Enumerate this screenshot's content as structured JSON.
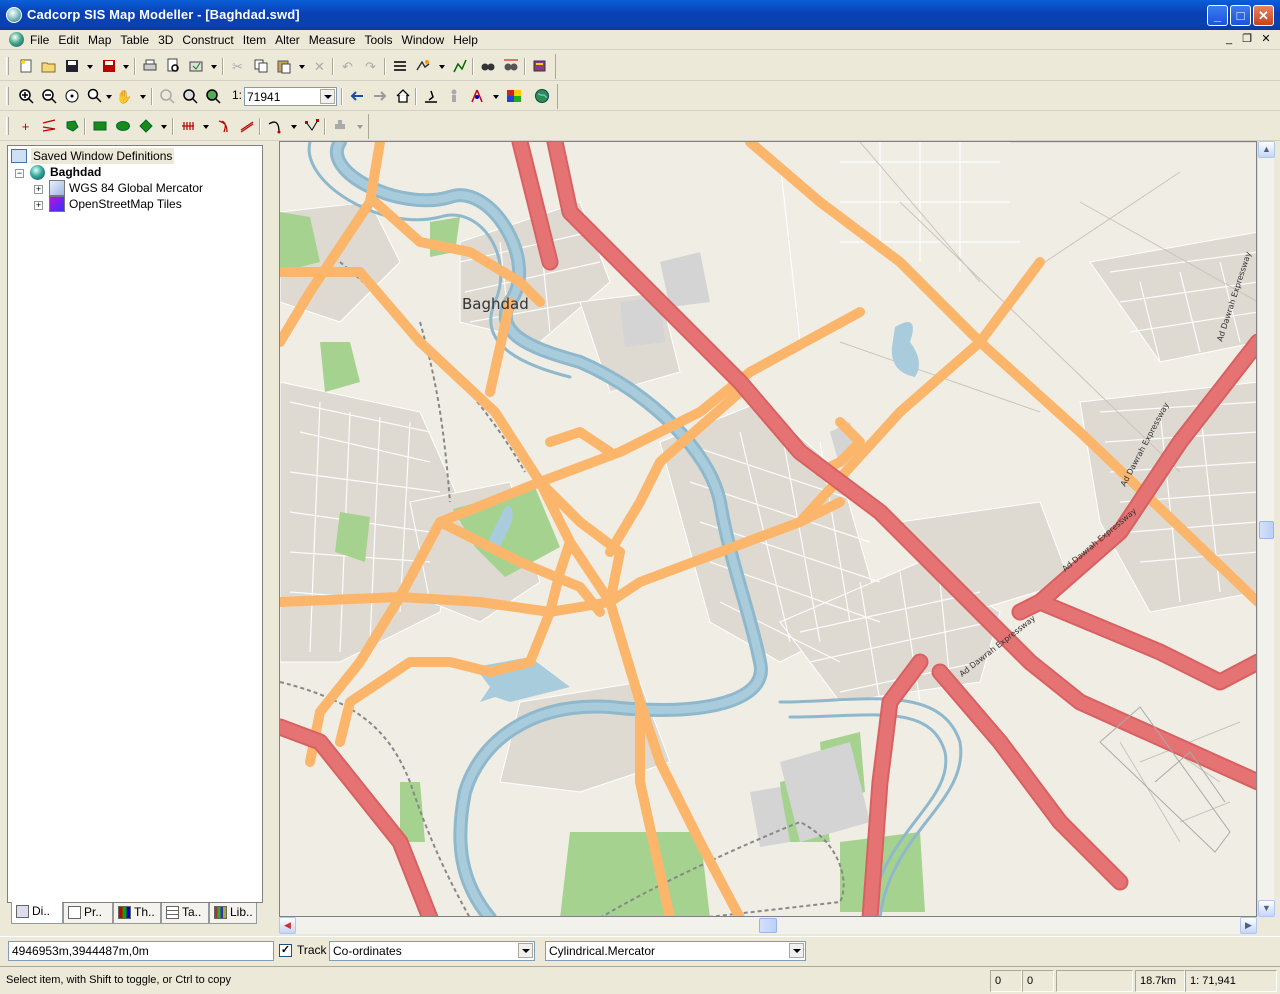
{
  "window": {
    "title": "Cadcorp SIS Map Modeller - [Baghdad.swd]",
    "minimize": "_",
    "maximize": "□",
    "close": "✕"
  },
  "menu": {
    "items": [
      "File",
      "Edit",
      "Map",
      "Table",
      "3D",
      "Construct",
      "Item",
      "Alter",
      "Measure",
      "Tools",
      "Window",
      "Help"
    ],
    "mdi_minimize": "_",
    "mdi_restore": "❐",
    "mdi_close": "✕"
  },
  "toolbar": {
    "scale_prefix": "1:",
    "scale_value": "71941"
  },
  "tree": {
    "root": "Saved Window Definitions",
    "map_node": "Baghdad",
    "layers": [
      "WGS 84 Global Mercator",
      "OpenStreetMap Tiles"
    ]
  },
  "tabs": [
    "Di..",
    "Pr..",
    "Th..",
    "Ta..",
    "Lib.."
  ],
  "map": {
    "city_label": "Baghdad",
    "road_labels": [
      "Ad Dawrah Expressway",
      "Ad Dawrah Expressway",
      "Ad Dawrah Expressway",
      "Ad Dawrah Expressway"
    ],
    "colors": {
      "background": "#f0ede5",
      "primary_road": "#e57373",
      "secondary_road": "#fcb66b",
      "river": "#8fb8cc",
      "river_fill": "#a9ccdc",
      "park": "#a6d28f",
      "urban": "#dedad2"
    }
  },
  "coords": {
    "value": "4946953m,3944487m,0m",
    "track_label": "Track",
    "track_checked": true,
    "mode": "Co-ordinates",
    "projection": "Cylindrical.Mercator"
  },
  "status": {
    "hint": "Select item, with Shift to toggle, or Ctrl to copy",
    "cell1": "0",
    "cell2": "0",
    "cell3": "",
    "distance": "18.7km",
    "scale": "1: 71,941"
  }
}
